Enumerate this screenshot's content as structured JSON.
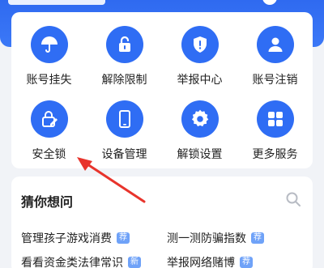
{
  "services": [
    {
      "label": "账号挂失",
      "icon": "umbrella-icon"
    },
    {
      "label": "解除限制",
      "icon": "unlock-icon"
    },
    {
      "label": "举报中心",
      "icon": "shield-alert-icon"
    },
    {
      "label": "账号注销",
      "icon": "user-icon"
    },
    {
      "label": "安全锁",
      "icon": "security-lock-icon"
    },
    {
      "label": "设备管理",
      "icon": "phone-icon"
    },
    {
      "label": "解锁设置",
      "icon": "gear-icon"
    },
    {
      "label": "更多服务",
      "icon": "grid-icon"
    }
  ],
  "guess": {
    "title": "猜你想问",
    "search_icon": "search-icon",
    "questions": [
      {
        "text": "管理孩子游戏消费",
        "badge": "荐"
      },
      {
        "text": "测一测防骗指数",
        "badge": "荐"
      },
      {
        "text": "看看资金类法律常识",
        "badge": "新"
      },
      {
        "text": "举报网络赌博",
        "badge": "荐"
      }
    ]
  },
  "colors": {
    "brand_blue": "#2f6df4",
    "arrow_red": "#e8342c",
    "badge_blue": "#6fa2f8"
  }
}
